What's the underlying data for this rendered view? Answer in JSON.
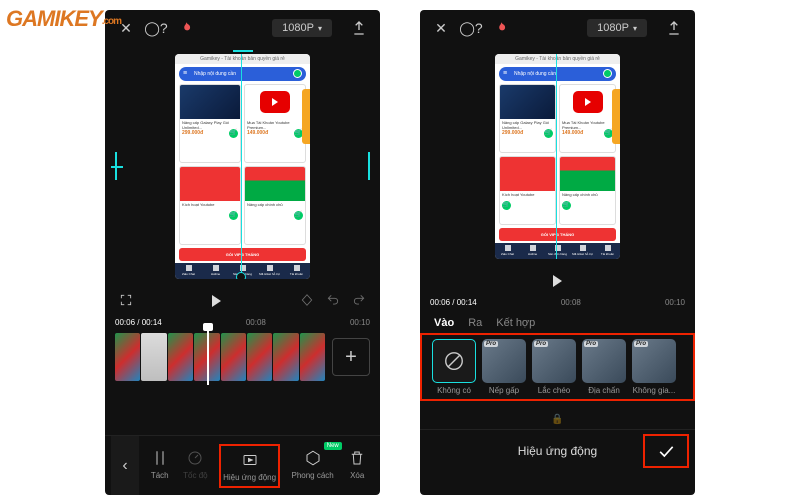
{
  "watermark": {
    "brand": "Gamikey",
    "suffix": ".com"
  },
  "header": {
    "resolution": "1080P"
  },
  "canvas_content": {
    "topbar": "Gamikey - Tài khoản bản quyền giá rẻ",
    "search_text": "Nhập nội dung cần",
    "cards": [
      {
        "desc": "Nâng cấp Galaxy Play Gói Unlimited...",
        "price": "299.000đ"
      },
      {
        "desc": "Mua Tài Khoản Youtube Premium...",
        "price": "149.000đ"
      },
      {
        "desc": "Kích hoạt Youtube",
        "price": ""
      },
      {
        "desc": "Nâng cấp chính chủ",
        "price": ""
      }
    ],
    "banner": "GÓI VIP 3 THÁNG",
    "bottomnav": [
      "Zalo Chat",
      "Hotline",
      "Sản đơn hàng",
      "Mã ticket hỗ trợ",
      "Tài khoản"
    ]
  },
  "playback": {
    "current_time": "00:06",
    "total_time": "00:14",
    "ruler": [
      "00:06",
      "00:14",
      "00:08",
      "00:10"
    ],
    "ruler_right": [
      "00:06",
      "00:14",
      "00:08",
      "00:10"
    ]
  },
  "toolbar_left": {
    "items": [
      {
        "key": "split",
        "label": "Tách"
      },
      {
        "key": "speed",
        "label": "Tốc độ"
      },
      {
        "key": "animation",
        "label": "Hiệu ứng động"
      },
      {
        "key": "style",
        "label": "Phong cách",
        "badge": "New"
      },
      {
        "key": "delete",
        "label": "Xóa"
      }
    ]
  },
  "anim_panel": {
    "tabs": [
      {
        "key": "in",
        "label": "Vào",
        "active": true
      },
      {
        "key": "out",
        "label": "Ra",
        "active": false
      },
      {
        "key": "combo",
        "label": "Kết hợp",
        "active": false
      }
    ],
    "items": [
      {
        "key": "none",
        "label": "Không có",
        "pro": false
      },
      {
        "key": "fold",
        "label": "Nếp gấp",
        "pro": true
      },
      {
        "key": "shake",
        "label": "Lắc chéo",
        "pro": true
      },
      {
        "key": "earthquake",
        "label": "Địa chấn",
        "pro": true
      },
      {
        "key": "nogap",
        "label": "Không gia...",
        "pro": true
      }
    ],
    "footer_title": "Hiệu ứng động"
  }
}
